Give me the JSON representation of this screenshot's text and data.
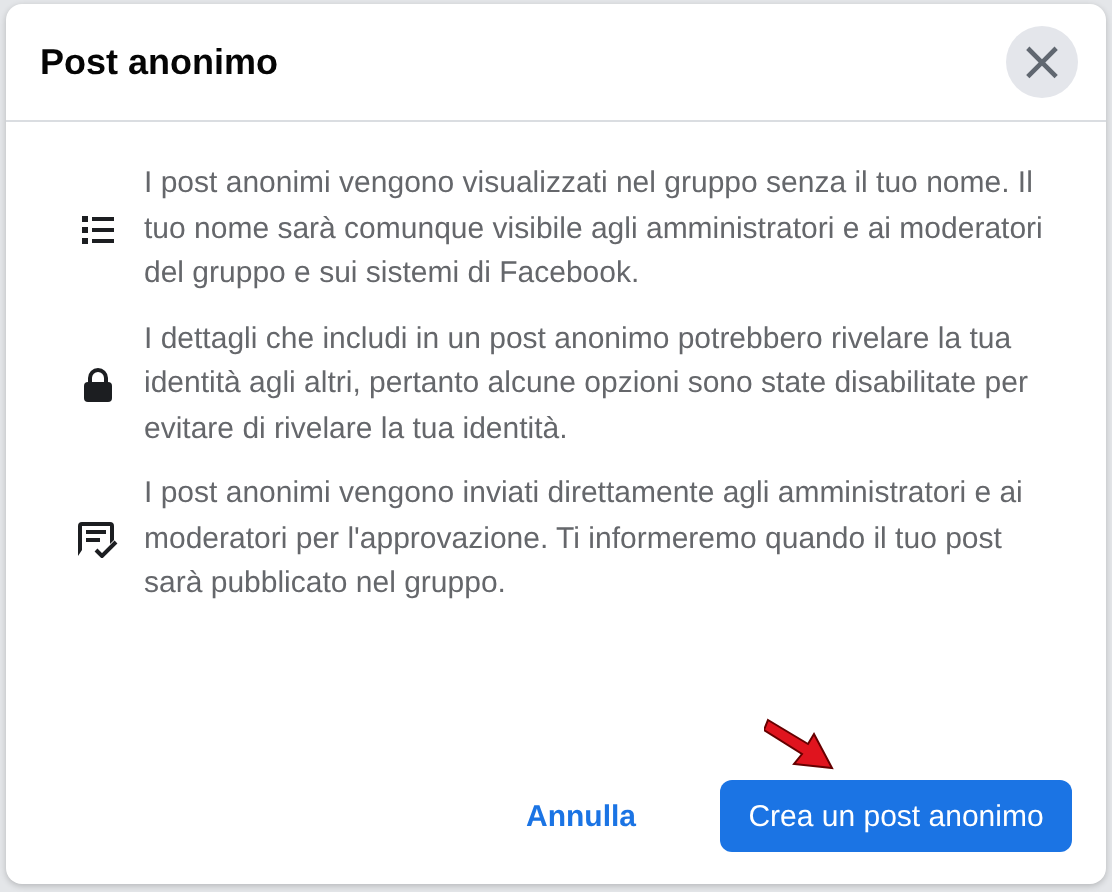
{
  "dialog": {
    "title": "Post anonimo",
    "close": "×"
  },
  "items": [
    {
      "kind": "list",
      "text": "I post anonimi vengono visualizzati nel gruppo senza il tuo nome. Il tuo nome sarà comunque visibile agli amministratori e ai moderatori del gruppo e sui sistemi di Facebook."
    },
    {
      "kind": "lock",
      "text": "I dettagli che includi in un post anonimo potrebbero rivelare la tua identità agli altri, pertanto alcune opzioni sono state disabilitate per evitare di rivelare la tua identità."
    },
    {
      "kind": "approve",
      "text": "I post anonimi vengono inviati direttamente agli amministratori e ai moderatori per l'approvazione. Ti informeremo quando il tuo post sarà pubblicato nel gruppo."
    }
  ],
  "buttons": [
    {
      "kind": "secondary",
      "label": "Annulla"
    },
    {
      "kind": "primary",
      "label": "Crea un post anonimo"
    }
  ]
}
